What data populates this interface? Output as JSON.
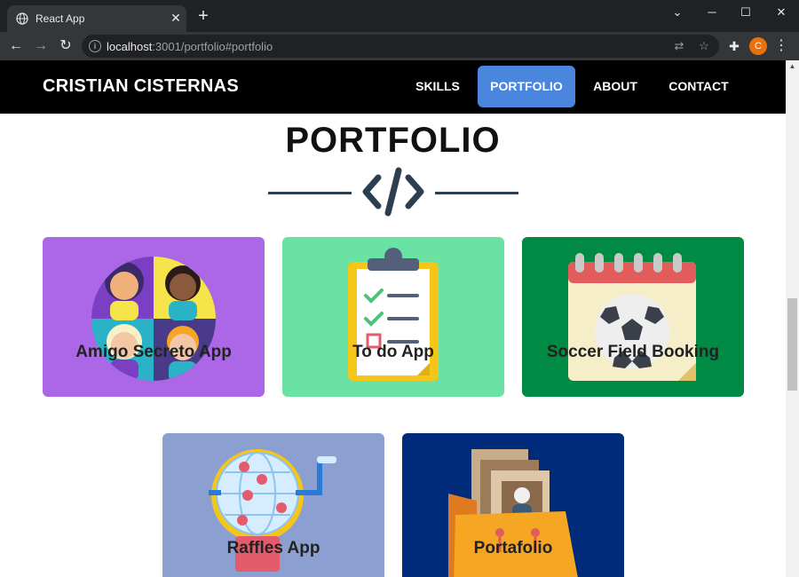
{
  "browser": {
    "tab_title": "React App",
    "url_host": "localhost",
    "url_path": ":3001/portfolio#portfolio",
    "avatar_letter": "C"
  },
  "site": {
    "brand": "CRISTIAN CISTERNAS",
    "nav": [
      {
        "label": "SKILLS",
        "active": false
      },
      {
        "label": "PORTFOLIO",
        "active": true
      },
      {
        "label": "ABOUT",
        "active": false
      },
      {
        "label": "CONTACT",
        "active": false
      }
    ],
    "section_title": "PORTFOLIO"
  },
  "projects": [
    {
      "title": "Amigo Secreto App",
      "bg": "#ab67e6"
    },
    {
      "title": "To do App",
      "bg": "#6ae2a4"
    },
    {
      "title": "Soccer Field Booking",
      "bg": "#008a44"
    },
    {
      "title": "Raffles App",
      "bg": "#8b9fd0"
    },
    {
      "title": "Portafolio",
      "bg": "#002a7a"
    }
  ],
  "colors": {
    "accent": "#4b86de",
    "nav_bg": "#000000",
    "divider": "#2c3e50"
  }
}
